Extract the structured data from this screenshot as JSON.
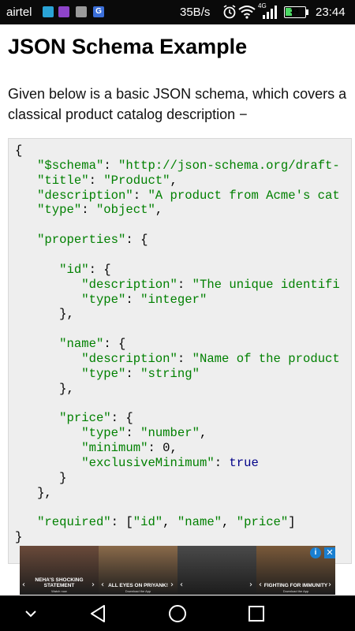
{
  "status_bar": {
    "carrier": "airtel",
    "network_speed": "35B/s",
    "network_type": "4G",
    "battery": "33",
    "time": "23:44",
    "app_icons": [
      "app-icon",
      "gallery-icon",
      "media-icon",
      "google-icon"
    ],
    "app_icon_letters": [
      "",
      "",
      "",
      "G"
    ]
  },
  "page": {
    "title": "JSON Schema Example",
    "intro": "Given below is a basic JSON schema, which covers a classical product catalog description −"
  },
  "code": {
    "lines": [
      [
        {
          "t": "{",
          "c": "pl"
        }
      ],
      [
        {
          "t": "   ",
          "c": "pl"
        },
        {
          "t": "\"$schema\"",
          "c": "str"
        },
        {
          "t": ": ",
          "c": "pl"
        },
        {
          "t": "\"http://json-schema.org/draft-",
          "c": "str"
        }
      ],
      [
        {
          "t": "   ",
          "c": "pl"
        },
        {
          "t": "\"title\"",
          "c": "str"
        },
        {
          "t": ": ",
          "c": "pl"
        },
        {
          "t": "\"Product\"",
          "c": "str"
        },
        {
          "t": ",",
          "c": "pl"
        }
      ],
      [
        {
          "t": "   ",
          "c": "pl"
        },
        {
          "t": "\"description\"",
          "c": "str"
        },
        {
          "t": ": ",
          "c": "pl"
        },
        {
          "t": "\"A product from Acme's cat",
          "c": "str"
        }
      ],
      [
        {
          "t": "   ",
          "c": "pl"
        },
        {
          "t": "\"type\"",
          "c": "str"
        },
        {
          "t": ": ",
          "c": "pl"
        },
        {
          "t": "\"object\"",
          "c": "str"
        },
        {
          "t": ",",
          "c": "pl"
        }
      ],
      [],
      [
        {
          "t": "   ",
          "c": "pl"
        },
        {
          "t": "\"properties\"",
          "c": "str"
        },
        {
          "t": ": {",
          "c": "pl"
        }
      ],
      [],
      [
        {
          "t": "      ",
          "c": "pl"
        },
        {
          "t": "\"id\"",
          "c": "str"
        },
        {
          "t": ": {",
          "c": "pl"
        }
      ],
      [
        {
          "t": "         ",
          "c": "pl"
        },
        {
          "t": "\"description\"",
          "c": "str"
        },
        {
          "t": ": ",
          "c": "pl"
        },
        {
          "t": "\"The unique identifi",
          "c": "str"
        }
      ],
      [
        {
          "t": "         ",
          "c": "pl"
        },
        {
          "t": "\"type\"",
          "c": "str"
        },
        {
          "t": ": ",
          "c": "pl"
        },
        {
          "t": "\"integer\"",
          "c": "str"
        }
      ],
      [
        {
          "t": "      },",
          "c": "pl"
        }
      ],
      [],
      [
        {
          "t": "      ",
          "c": "pl"
        },
        {
          "t": "\"name\"",
          "c": "str"
        },
        {
          "t": ": {",
          "c": "pl"
        }
      ],
      [
        {
          "t": "         ",
          "c": "pl"
        },
        {
          "t": "\"description\"",
          "c": "str"
        },
        {
          "t": ": ",
          "c": "pl"
        },
        {
          "t": "\"Name of the product",
          "c": "str"
        }
      ],
      [
        {
          "t": "         ",
          "c": "pl"
        },
        {
          "t": "\"type\"",
          "c": "str"
        },
        {
          "t": ": ",
          "c": "pl"
        },
        {
          "t": "\"string\"",
          "c": "str"
        }
      ],
      [
        {
          "t": "      },",
          "c": "pl"
        }
      ],
      [],
      [
        {
          "t": "      ",
          "c": "pl"
        },
        {
          "t": "\"price\"",
          "c": "str"
        },
        {
          "t": ": {",
          "c": "pl"
        }
      ],
      [
        {
          "t": "         ",
          "c": "pl"
        },
        {
          "t": "\"type\"",
          "c": "str"
        },
        {
          "t": ": ",
          "c": "pl"
        },
        {
          "t": "\"number\"",
          "c": "str"
        },
        {
          "t": ",",
          "c": "pl"
        }
      ],
      [
        {
          "t": "         ",
          "c": "pl"
        },
        {
          "t": "\"minimum\"",
          "c": "str"
        },
        {
          "t": ": 0,",
          "c": "pl"
        }
      ],
      [
        {
          "t": "         ",
          "c": "pl"
        },
        {
          "t": "\"exclusiveMinimum\"",
          "c": "str"
        },
        {
          "t": ": ",
          "c": "pl"
        },
        {
          "t": "true",
          "c": "kw"
        }
      ],
      [
        {
          "t": "      }",
          "c": "pl"
        }
      ],
      [
        {
          "t": "   },",
          "c": "pl"
        }
      ],
      [],
      [
        {
          "t": "   ",
          "c": "pl"
        },
        {
          "t": "\"required\"",
          "c": "str"
        },
        {
          "t": ": [",
          "c": "pl"
        },
        {
          "t": "\"id\"",
          "c": "str"
        },
        {
          "t": ", ",
          "c": "pl"
        },
        {
          "t": "\"name\"",
          "c": "str"
        },
        {
          "t": ", ",
          "c": "pl"
        },
        {
          "t": "\"price\"",
          "c": "str"
        },
        {
          "t": "]",
          "c": "pl"
        }
      ],
      [
        {
          "t": "}",
          "c": "pl"
        }
      ]
    ],
    "colors": {
      "str": "#008000",
      "kw": "#000088",
      "pl": "#000000"
    }
  },
  "ad": {
    "panels": [
      {
        "caption": "NEHA'S SHOCKING STATEMENT",
        "sub": "Watch now",
        "color": "#6a4a3a"
      },
      {
        "caption": "ALL EYES ON PRIYANK!",
        "sub": "Download the App",
        "color": "#8a6a4a"
      },
      {
        "caption": "",
        "sub": "",
        "color": "#4a4a4a"
      },
      {
        "caption": "FIGHTING FOR IMMUNITY",
        "sub": "Download the App",
        "color": "#7a5a3a"
      }
    ],
    "info_icon": "i",
    "close_icon": "✕"
  },
  "nav": {
    "buttons": [
      "down-chevron-icon",
      "back-icon",
      "home-icon",
      "recents-icon"
    ]
  }
}
